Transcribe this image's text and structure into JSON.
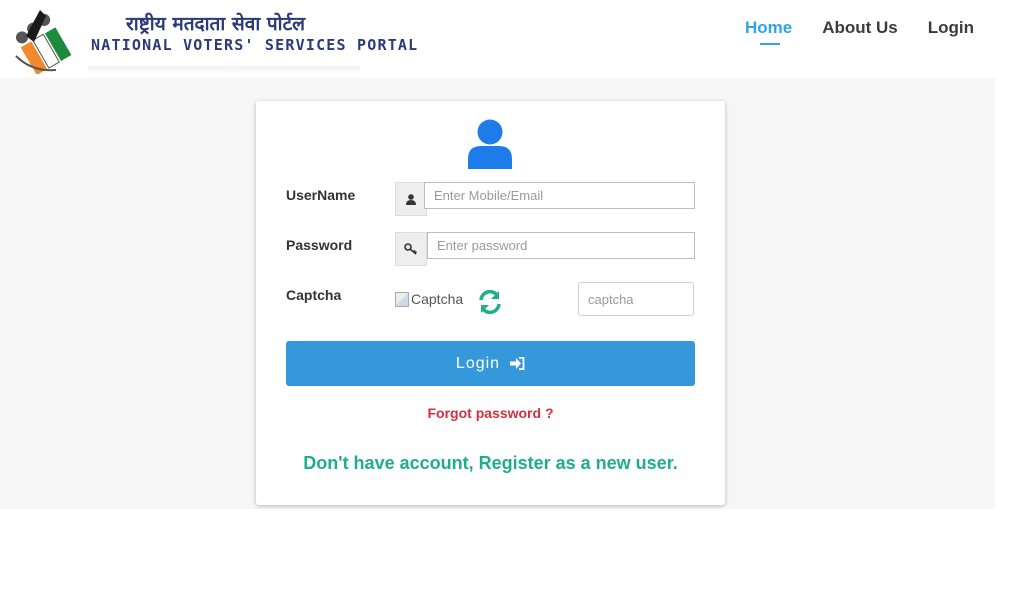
{
  "header": {
    "logo_hindi": "राष्ट्रीय मतदाता सेवा पोर्टल",
    "logo_english": "NATIONAL VOTERS' SERVICES PORTAL",
    "nav": [
      {
        "label": "Home",
        "active": true
      },
      {
        "label": "About Us",
        "active": false
      },
      {
        "label": "Login",
        "active": false
      }
    ]
  },
  "form": {
    "user_icon": "user-icon",
    "username_label": "UserName",
    "username_placeholder": "Enter Mobile/Email",
    "username_icon": "user-small-icon",
    "password_label": "Password",
    "password_placeholder": "Enter password",
    "password_icon": "key-icon",
    "captcha_label": "Captcha",
    "captcha_image_alt": "Captcha",
    "captcha_refresh_icon": "refresh-icon",
    "captcha_placeholder": "captcha",
    "login_button": "Login",
    "login_button_icon": "sign-in-icon",
    "forgot_password": "Forgot password ?",
    "register_text": "Don't have account, Register as a new user."
  },
  "colors": {
    "accent": "#2fa4e7",
    "primary_button": "#3498db",
    "forgot_link": "#d32f3f",
    "register_link": "#1fae8c",
    "user_icon": "#1e7bea"
  }
}
